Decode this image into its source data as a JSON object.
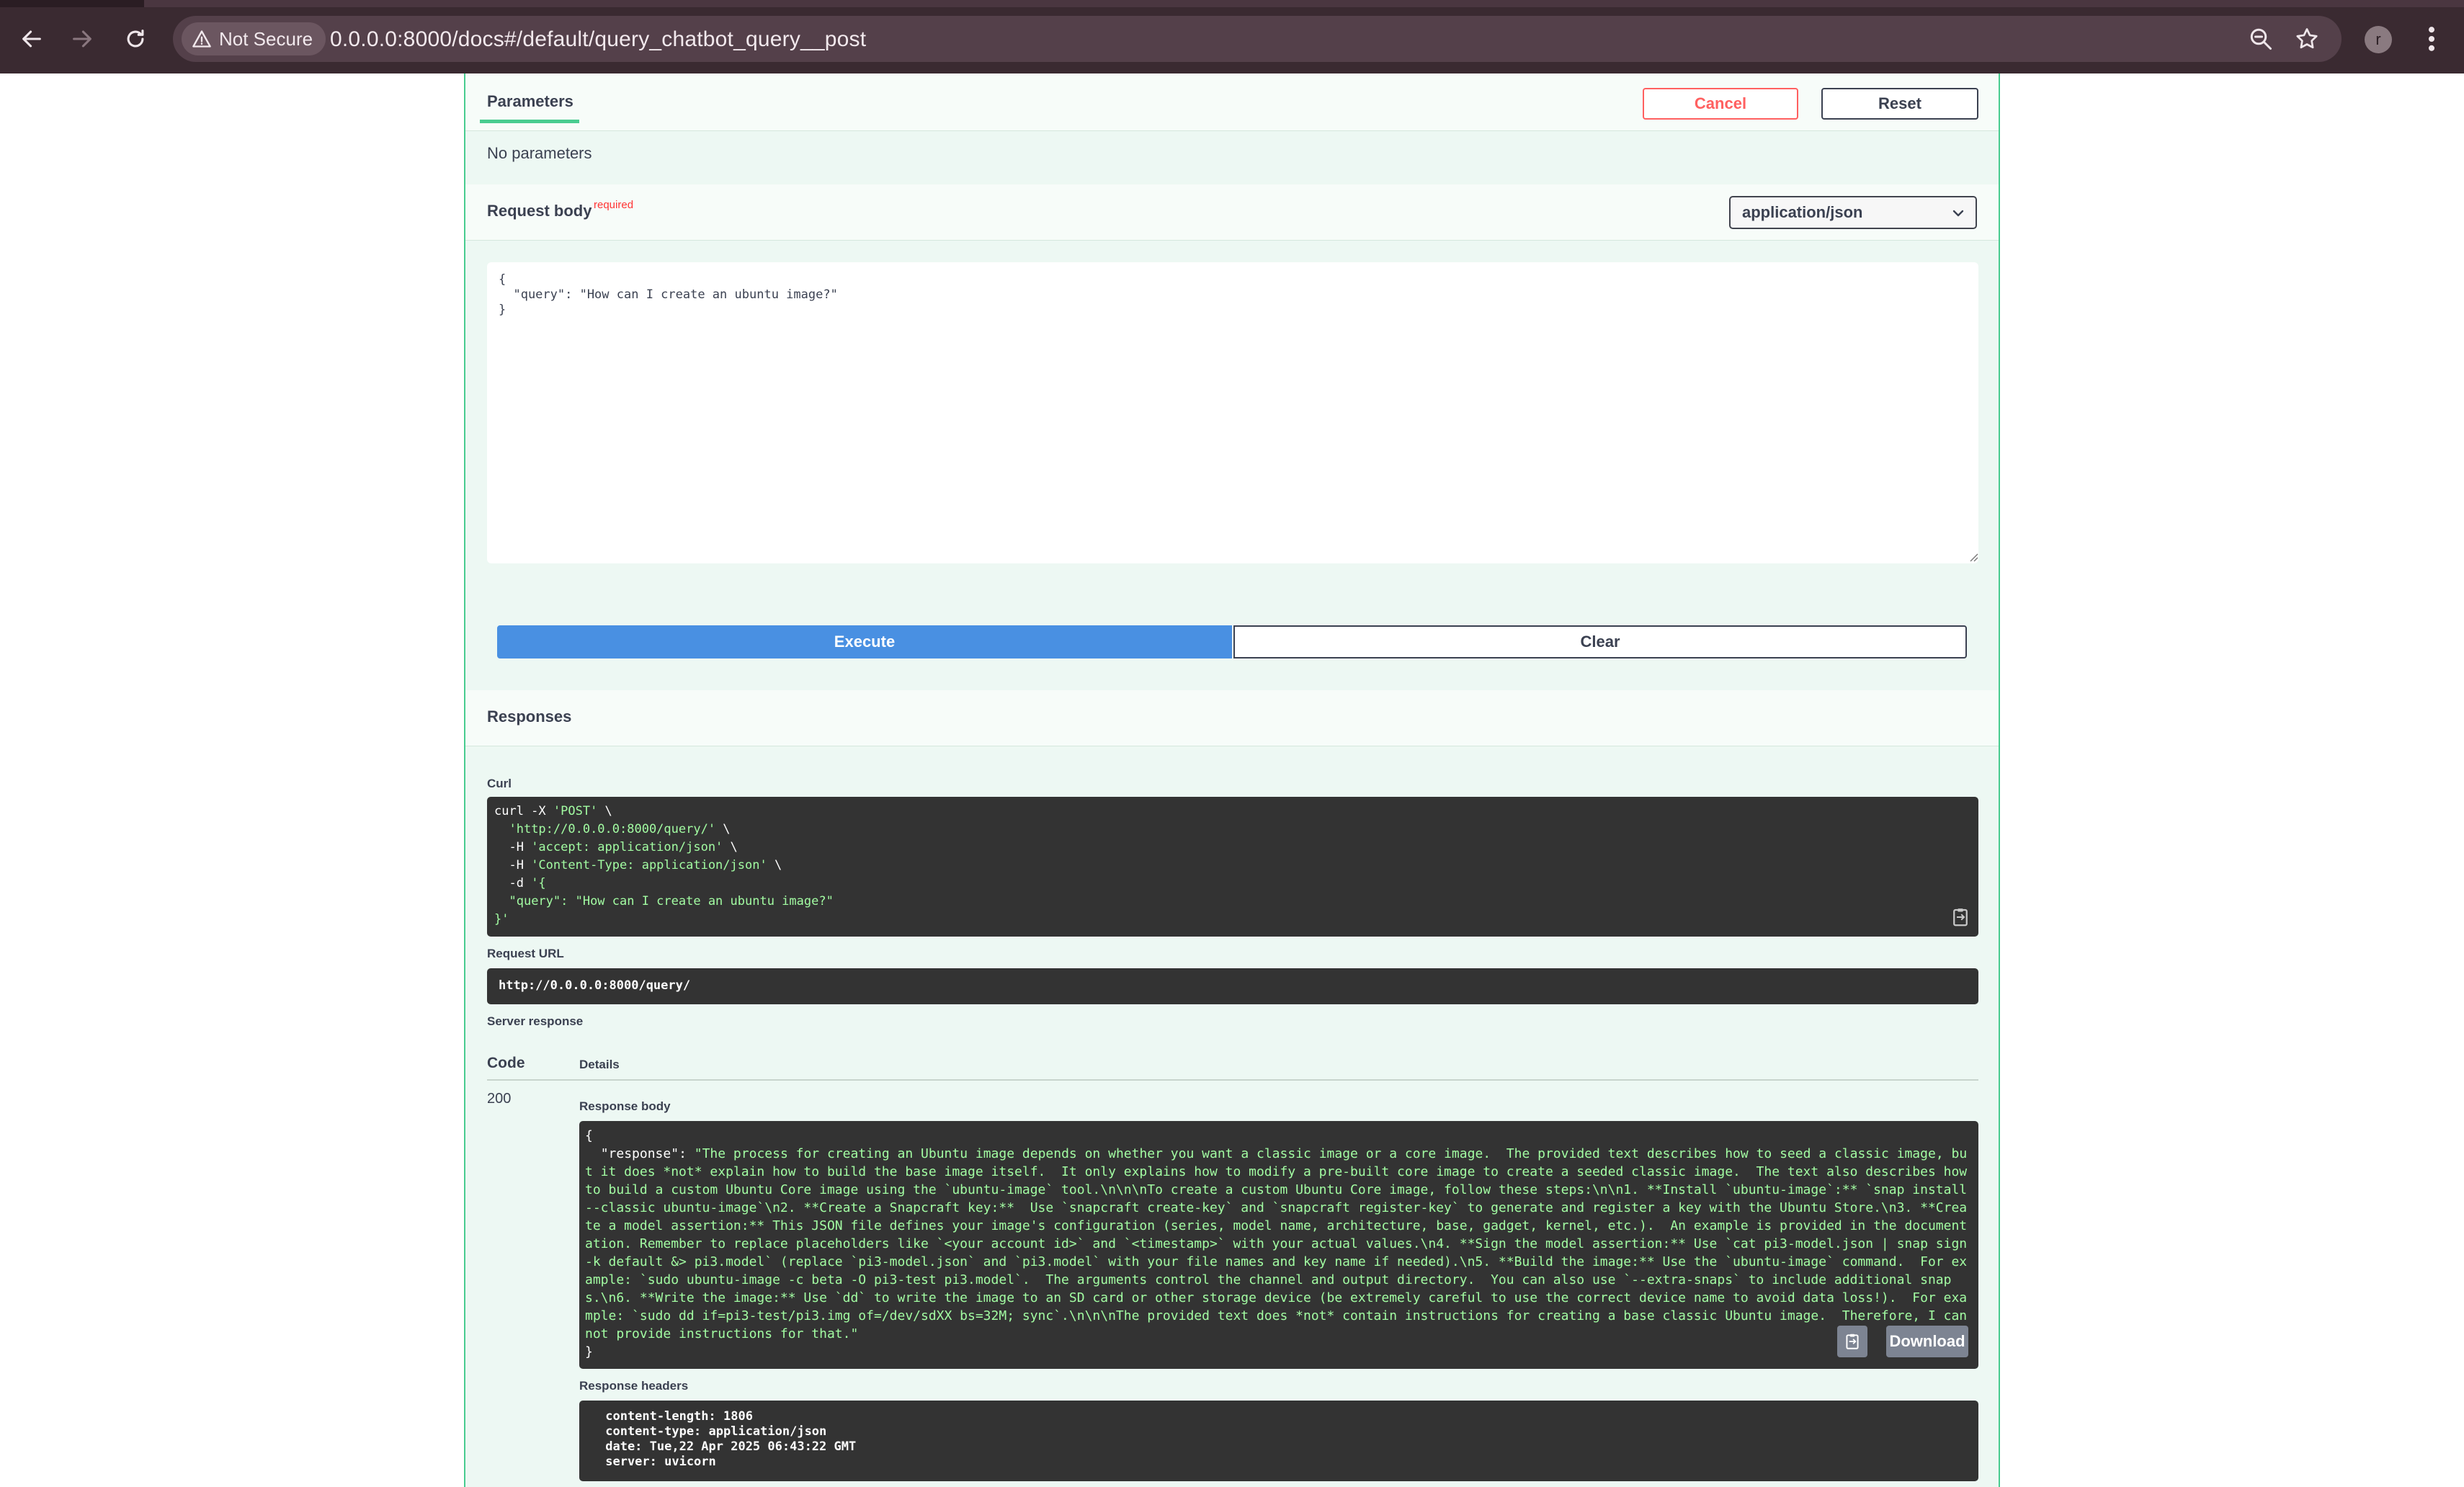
{
  "browser": {
    "security_label": "Not Secure",
    "url": "0.0.0.0:8000/docs#/default/query_chatbot_query__post",
    "profile_initial": "r"
  },
  "parameters": {
    "tab_label": "Parameters",
    "cancel_label": "Cancel",
    "reset_label": "Reset",
    "empty_text": "No parameters"
  },
  "request_body": {
    "title": "Request body",
    "required_label": "required",
    "content_type": "application/json",
    "body_text": "{\n  \"query\": \"How can I create an ubuntu image?\"\n}"
  },
  "actions": {
    "execute_label": "Execute",
    "clear_label": "Clear"
  },
  "responses": {
    "title": "Responses",
    "curl_label": "Curl",
    "curl_lines": [
      {
        "pre": "curl -X ",
        "str": "'POST'",
        "post": " \\"
      },
      {
        "pre": "  ",
        "str": "'http://0.0.0.0:8000/query/'",
        "post": " \\"
      },
      {
        "pre": "  -H ",
        "str": "'accept: application/json'",
        "post": " \\"
      },
      {
        "pre": "  -H ",
        "str": "'Content-Type: application/json'",
        "post": " \\"
      },
      {
        "pre": "  -d ",
        "str": "'{",
        "post": ""
      },
      {
        "pre": "  ",
        "str": "\"query\": \"How can I create an ubuntu image?\"",
        "post": ""
      },
      {
        "pre": "",
        "str": "}'",
        "post": ""
      }
    ],
    "request_url_label": "Request URL",
    "request_url": "http://0.0.0.0:8000/query/",
    "server_response_label": "Server response",
    "code_header": "Code",
    "details_header": "Details",
    "status_code": "200",
    "response_body_label": "Response body",
    "response_key": "\"response\"",
    "response_value": "\"The process for creating an Ubuntu image depends on whether you want a classic image or a core image.  The provided text describes how to seed a classic image, but it does *not* explain how to build the base image itself.  It only explains how to modify a pre-built core image to create a seeded classic image.  The text also describes how to build a custom Ubuntu Core image using the `ubuntu-image` tool.\\n\\n\\nTo create a custom Ubuntu Core image, follow these steps:\\n\\n1. **Install `ubuntu-image`:** `snap install --classic ubuntu-image`\\n2. **Create a Snapcraft key:**  Use `snapcraft create-key` and `snapcraft register-key` to generate and register a key with the Ubuntu Store.\\n3. **Create a model assertion:** This JSON file defines your image's configuration (series, model name, architecture, base, gadget, kernel, etc.).  An example is provided in the documentation. Remember to replace placeholders like `<your account id>` and `<timestamp>` with your actual values.\\n4. **Sign the model assertion:** Use `cat pi3-model.json | snap sign -k default &> pi3.model` (replace `pi3-model.json` and `pi3.model` with your file names and key name if needed).\\n5. **Build the image:** Use the `ubuntu-image` command.  For example: `sudo ubuntu-image -c beta -O pi3-test pi3.model`.  The arguments control the channel and output directory.  You can also use `--extra-snaps` to include additional snaps.\\n6. **Write the image:** Use `dd` to write the image to an SD card or other storage device (be extremely careful to use the correct device name to avoid data loss!).  For example: `sudo dd if=pi3-test/pi3.img of=/dev/sdXX bs=32M; sync`.\\n\\n\\nThe provided text does *not* contain instructions for creating a base classic Ubuntu image.  Therefore, I cannot provide instructions for that.\"",
    "download_label": "Download",
    "response_headers_label": "Response headers",
    "headers_text": " content-length: 1806 \n content-type: application/json \n date: Tue,22 Apr 2025 06:43:22 GMT \n server: uvicorn "
  }
}
